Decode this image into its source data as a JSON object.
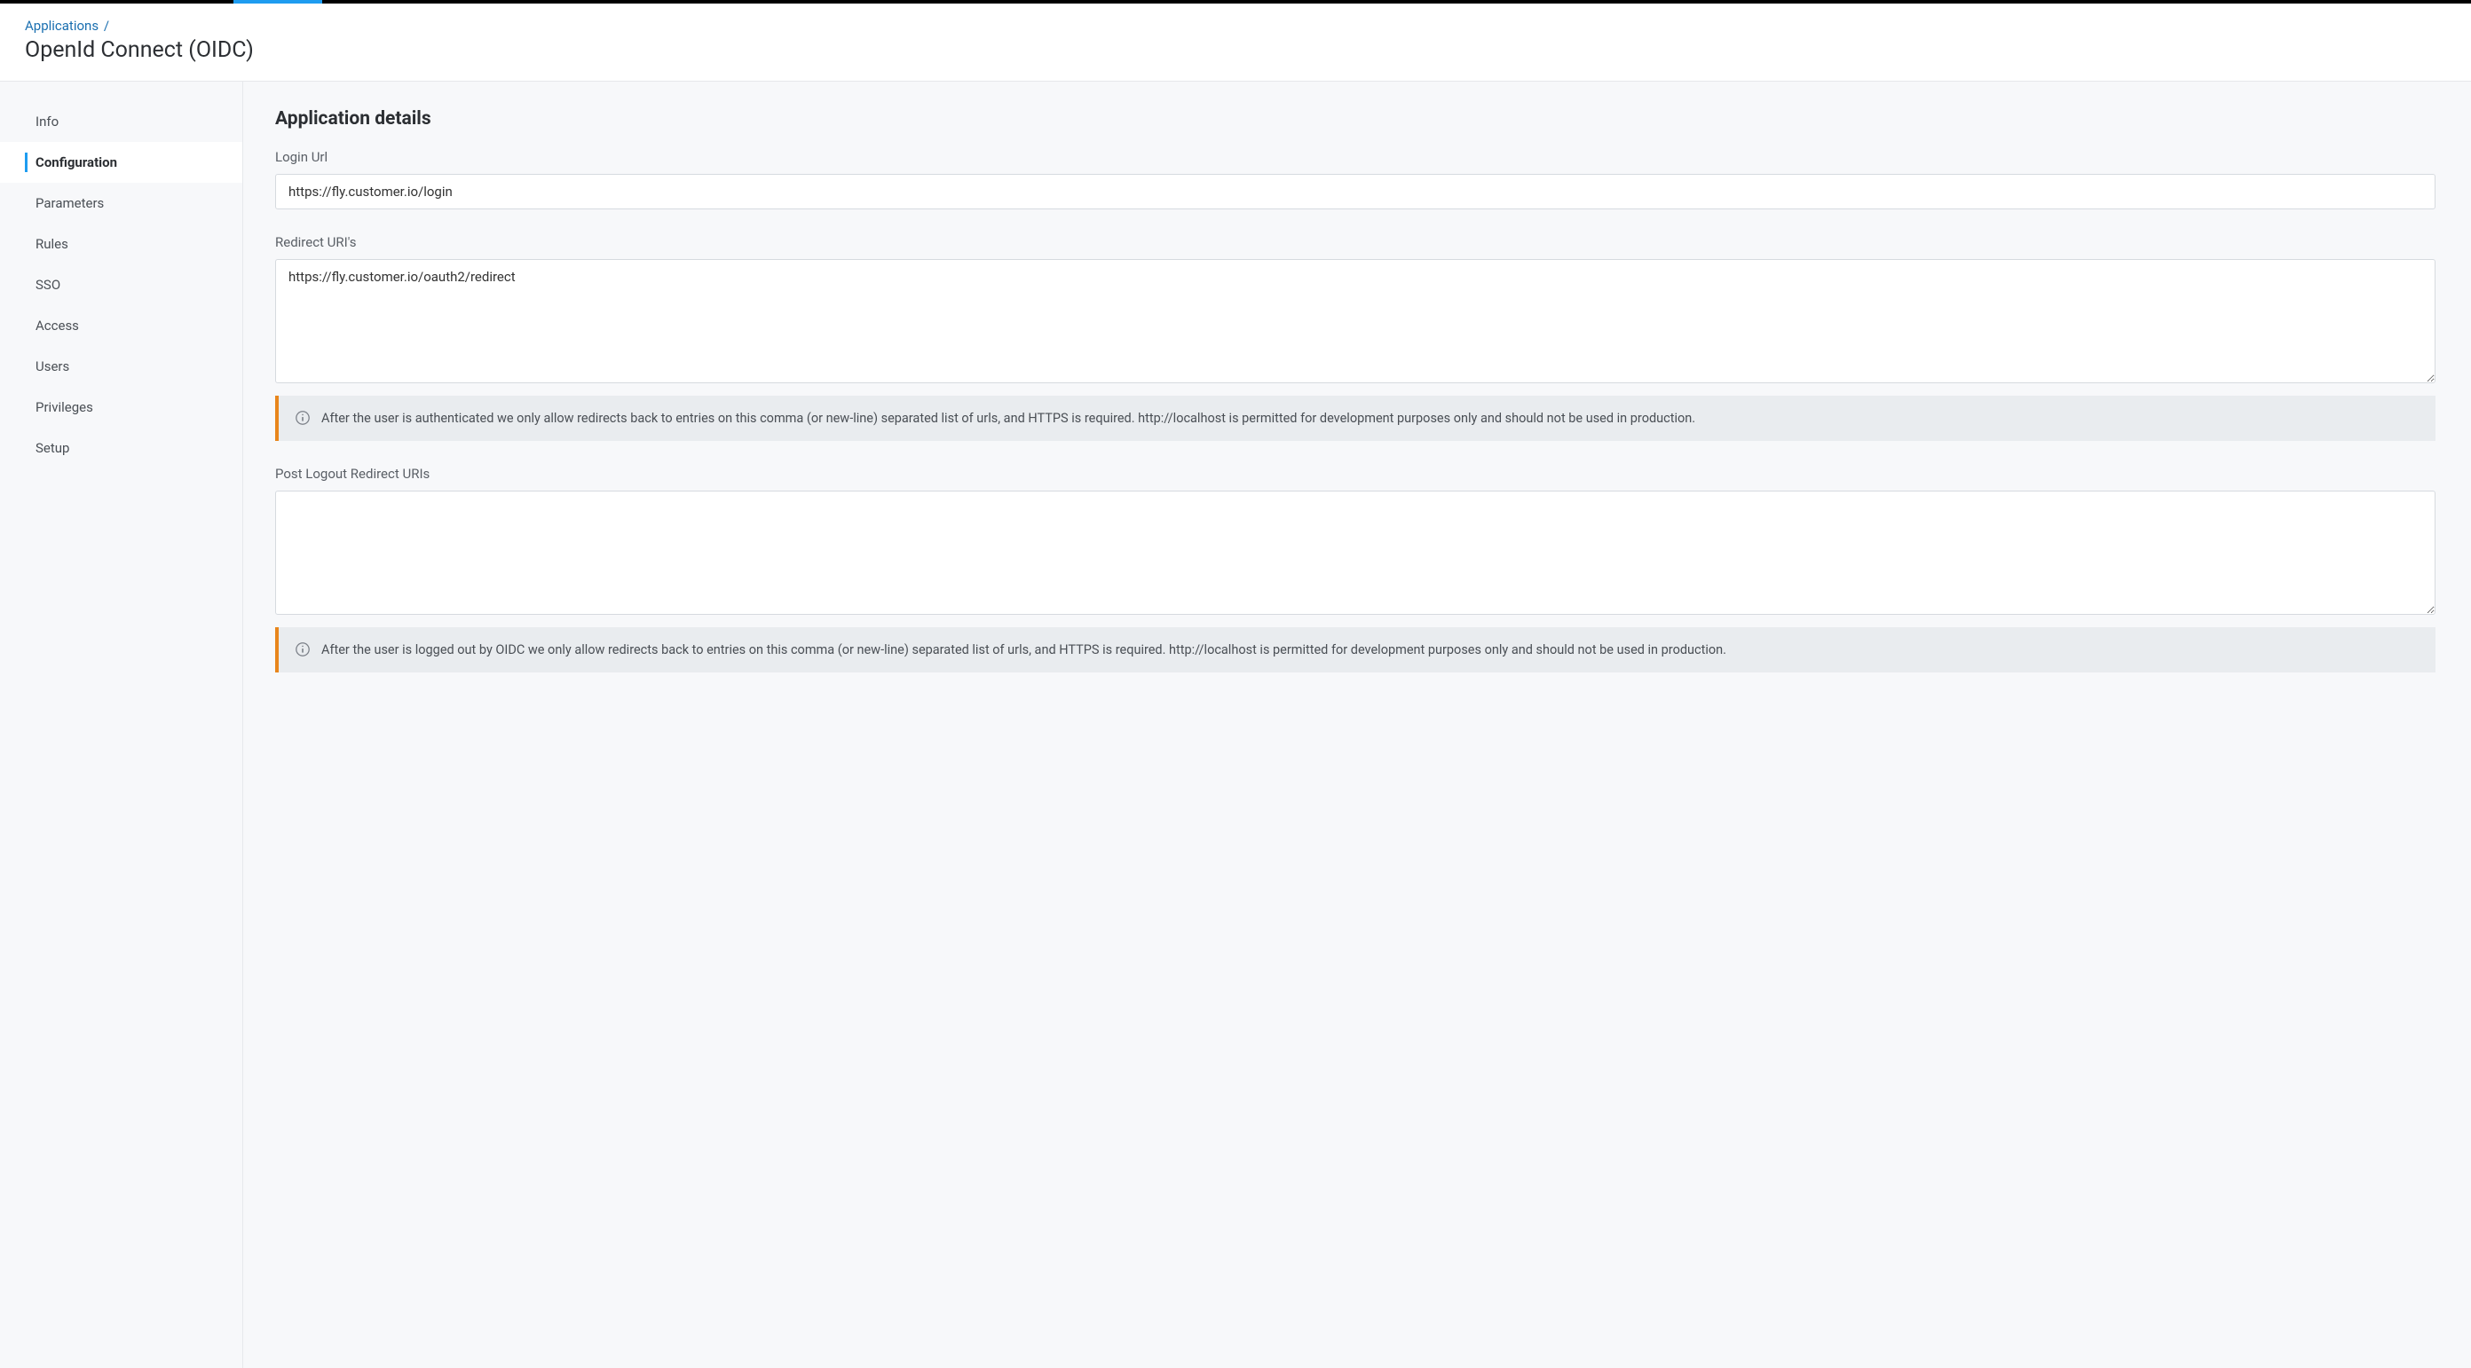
{
  "breadcrumb": {
    "parent": "Applications",
    "separator": "/"
  },
  "page_title": "OpenId Connect (OIDC)",
  "sidebar": {
    "items": [
      {
        "label": "Info",
        "active": false
      },
      {
        "label": "Configuration",
        "active": true
      },
      {
        "label": "Parameters",
        "active": false
      },
      {
        "label": "Rules",
        "active": false
      },
      {
        "label": "SSO",
        "active": false
      },
      {
        "label": "Access",
        "active": false
      },
      {
        "label": "Users",
        "active": false
      },
      {
        "label": "Privileges",
        "active": false
      },
      {
        "label": "Setup",
        "active": false
      }
    ]
  },
  "main": {
    "section_title": "Application details",
    "login_url": {
      "label": "Login Url",
      "value": "https://fly.customer.io/login"
    },
    "redirect_uris": {
      "label": "Redirect URI's",
      "value": "https://fly.customer.io/oauth2/redirect",
      "info": "After the user is authenticated we only allow redirects back to entries on this comma (or new-line) separated list of urls, and HTTPS is required. http://localhost is permitted for development purposes only and should not be used in production."
    },
    "post_logout_uris": {
      "label": "Post Logout Redirect URIs",
      "value": "",
      "info": "After the user is logged out by OIDC we only allow redirects back to entries on this comma (or new-line) separated list of urls, and HTTPS is required. http://localhost is permitted for development purposes only and should not be used in production."
    }
  }
}
